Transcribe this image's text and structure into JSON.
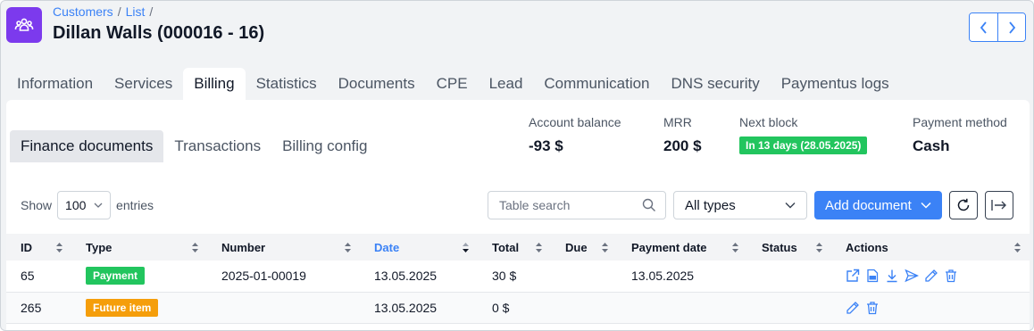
{
  "header": {
    "breadcrumb": [
      "Customers",
      "List"
    ],
    "breadcrumb_sep": "/",
    "title": "Dillan Walls (000016 - 16)",
    "logo_icon": "users-icon"
  },
  "main_tabs": [
    "Information",
    "Services",
    "Billing",
    "Statistics",
    "Documents",
    "CPE",
    "Lead",
    "Communication",
    "DNS security",
    "Paymentus logs"
  ],
  "active_main_tab": "Billing",
  "sub_tabs": [
    "Finance documents",
    "Transactions",
    "Billing config"
  ],
  "active_sub_tab": "Finance documents",
  "stats": {
    "account_balance": {
      "label": "Account balance",
      "value": "-93 $"
    },
    "mrr": {
      "label": "MRR",
      "value": "200 $"
    },
    "next_block": {
      "label": "Next block",
      "value": "In 13 days (28.05.2025)",
      "color": "#22c55e"
    },
    "payment_method": {
      "label": "Payment method",
      "value": "Cash"
    }
  },
  "controls": {
    "show_label": "Show",
    "entries_value": "100",
    "entries_label": "entries",
    "search_placeholder": "Table search",
    "type_filter": "All types",
    "add_button": "Add document"
  },
  "table": {
    "columns": [
      "ID",
      "Type",
      "Number",
      "Date",
      "Total",
      "Due",
      "Payment date",
      "Status",
      "Actions"
    ],
    "sorted_column": "Date",
    "rows": [
      {
        "id": "65",
        "type": "Payment",
        "type_color": "#22c55e",
        "number": "2025-01-00019",
        "date": "13.05.2025",
        "total": "30 $",
        "due": "",
        "payment_date": "13.05.2025",
        "status": "",
        "actions": [
          "open-external-icon",
          "pdf-icon",
          "download-icon",
          "send-icon",
          "edit-icon",
          "delete-icon"
        ]
      },
      {
        "id": "265",
        "type": "Future item",
        "type_color": "#f59e0b",
        "number": "",
        "date": "13.05.2025",
        "total": "0 $",
        "due": "",
        "payment_date": "",
        "status": "",
        "actions": [
          "edit-icon",
          "delete-icon"
        ]
      }
    ]
  },
  "colors": {
    "accent": "#3b82f6",
    "brand": "#7c3aed"
  }
}
